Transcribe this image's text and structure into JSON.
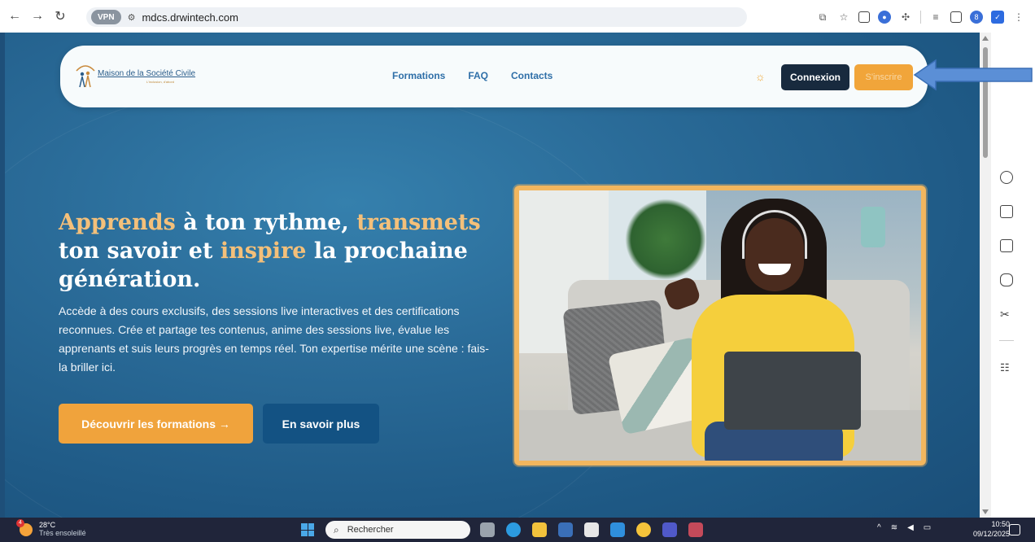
{
  "browser": {
    "vpn_label": "VPN",
    "url": "mdcs.drwintech.com"
  },
  "site": {
    "logo_name": "Maison de la Société Civile",
    "logo_tagline": "L'inclusion, d'abord",
    "nav": [
      "Formations",
      "FAQ",
      "Contacts"
    ],
    "login_label": "Connexion",
    "signup_label": "S'inscrire"
  },
  "hero": {
    "title_part1": "Apprends",
    "title_part2": " à ton rythme, ",
    "title_part3": "transmets",
    "title_part4": " ton savoir et ",
    "title_part5": "inspire",
    "title_part6": " la prochaine génération.",
    "description": "Accède à des cours exclusifs, des sessions live interactives et des certifications reconnues. Crée et partage tes contenus, anime des sessions live, évalue les apprenants et suis leurs progrès en temps réel. Ton expertise mérite une scène : fais-la briller ici.",
    "primary_cta": "Découvrir les formations →",
    "secondary_cta": "En savoir plus"
  },
  "taskbar": {
    "weather_temp": "28°C",
    "weather_desc": "Très ensoleillé",
    "weather_badge": "4",
    "search_placeholder": "Rechercher",
    "time": "10:50",
    "date": "09/12/2025"
  },
  "colors": {
    "accent_orange": "#f0a33c",
    "dark_navy": "#182a3e",
    "hero_blue": "#2a6b98",
    "accent_title": "#f4c07a"
  }
}
